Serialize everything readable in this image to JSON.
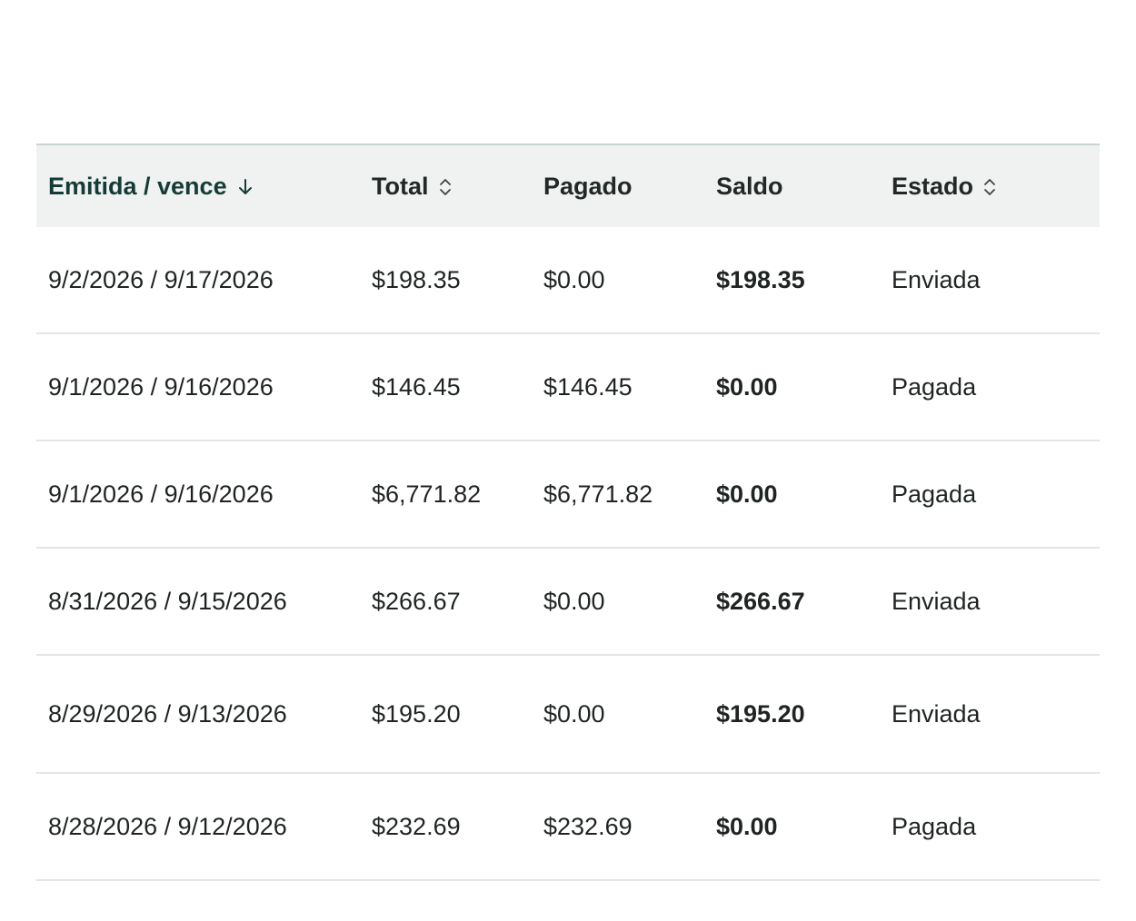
{
  "table": {
    "headers": {
      "issued_due": "Emitida / vence",
      "total": "Total",
      "paid": "Pagado",
      "balance": "Saldo",
      "status": "Estado"
    },
    "sort_icons": {
      "issued_due": "arrow-down-icon",
      "total": "sort-updown-icon",
      "status": "sort-updown-icon"
    },
    "rows": [
      {
        "dates": "9/2/2026 / 9/17/2026",
        "total": "$198.35",
        "paid": "$0.00",
        "balance": "$198.35",
        "status": "Enviada"
      },
      {
        "dates": "9/1/2026 / 9/16/2026",
        "total": "$146.45",
        "paid": "$146.45",
        "balance": "$0.00",
        "status": "Pagada"
      },
      {
        "dates": "9/1/2026 / 9/16/2026",
        "total": "$6,771.82",
        "paid": "$6,771.82",
        "balance": "$0.00",
        "status": "Pagada"
      },
      {
        "dates": "8/31/2026 / 9/15/2026",
        "total": "$266.67",
        "paid": "$0.00",
        "balance": "$266.67",
        "status": "Enviada"
      },
      {
        "dates": "8/29/2026 / 9/13/2026",
        "total": "$195.20",
        "paid": "$0.00",
        "balance": "$195.20",
        "status": "Enviada"
      },
      {
        "dates": "8/28/2026 / 9/12/2026",
        "total": "$232.69",
        "paid": "$232.69",
        "balance": "$0.00",
        "status": "Pagada"
      }
    ]
  },
  "colors": {
    "header_bg": "#f0f2f1",
    "active_header": "#163b36",
    "row_border": "#e3e6e5"
  }
}
